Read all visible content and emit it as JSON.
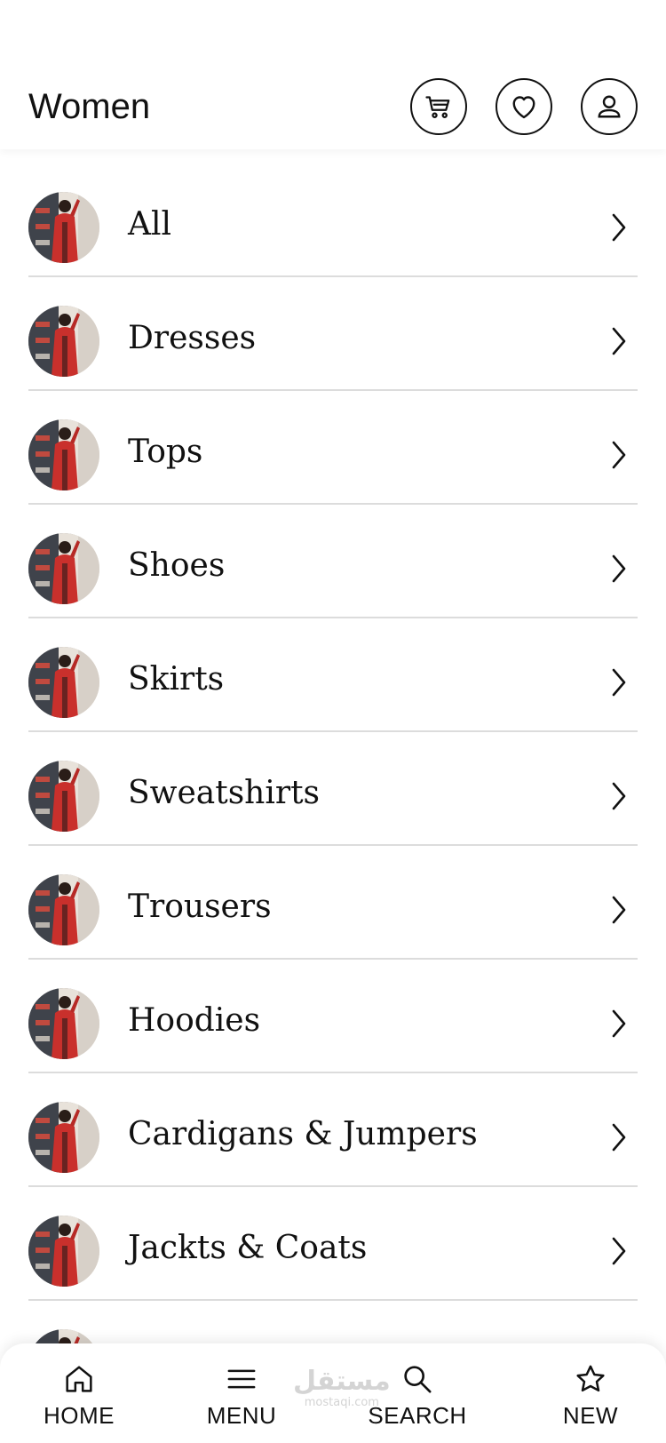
{
  "header": {
    "title": "Women",
    "cart_icon": "cart-icon",
    "wishlist_icon": "heart-icon",
    "profile_icon": "user-icon"
  },
  "categories": [
    {
      "label": "All"
    },
    {
      "label": "Dresses"
    },
    {
      "label": "Tops"
    },
    {
      "label": "Shoes"
    },
    {
      "label": "Skirts"
    },
    {
      "label": "Sweatshirts"
    },
    {
      "label": "Trousers"
    },
    {
      "label": "Hoodies"
    },
    {
      "label": "Cardigans & Jumpers"
    },
    {
      "label": "Jackts & Coats"
    },
    {
      "label": ""
    }
  ],
  "bottom_nav": {
    "home": "HOME",
    "menu": "MENU",
    "search": "SEARCH",
    "new": "NEW"
  },
  "watermark": {
    "main": "مستقل",
    "sub": "mostaqi.com"
  },
  "colors": {
    "text": "#111111",
    "divider": "#dcdcdc",
    "background": "#ffffff",
    "avatar_coat": "#c9302c"
  }
}
